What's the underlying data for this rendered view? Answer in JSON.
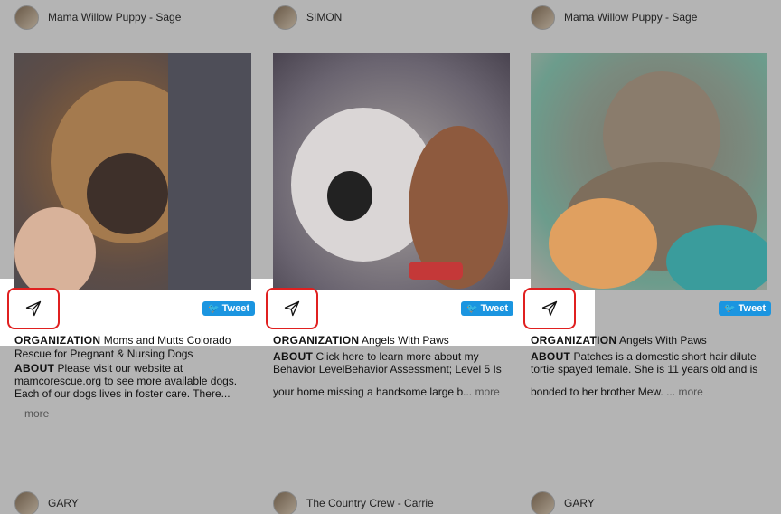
{
  "cards": [
    {
      "username": "Mama Willow Puppy - Sage",
      "org_label": "ORGANIZATION",
      "org_value": "Moms and Mutts Colorado Rescue for Pregnant & Nursing Dogs",
      "about_label": "ABOUT",
      "about_text": "Please visit our website at mamcorescue.org to see more available dogs. Each of our dogs lives in foster care. There...",
      "more": "more",
      "tweet": "Tweet"
    },
    {
      "username": "SIMON",
      "org_label": "ORGANIZATION",
      "org_value": "Angels With Paws",
      "about_label": "ABOUT",
      "about_text": "Click here to learn more about my Behavior LevelBehavior Assessment; Level 5 Is",
      "about_text2": "your home missing a handsome large b...",
      "more": "more",
      "tweet": "Tweet"
    },
    {
      "username": "Mama Willow Puppy - Sage",
      "org_label": "ORGANIZATION",
      "org_value": "Angels With Paws",
      "about_label": "ABOUT",
      "about_text": "Patches is a domestic short hair dilute tortie spayed female. She is 11 years old and is",
      "about_text2": "bonded to her brother Mew. ...",
      "more": "more",
      "tweet": "Tweet"
    }
  ],
  "next_row": [
    {
      "username": "GARY"
    },
    {
      "username": "The Country Crew - Carrie"
    },
    {
      "username": "GARY"
    }
  ],
  "icons": {
    "share": "paper-plane-icon",
    "twitter": "twitter-bird-icon"
  },
  "colors": {
    "highlight_border": "#e02020",
    "tweet_bg": "#1b95e0",
    "overlay": "#b4b4b4"
  }
}
